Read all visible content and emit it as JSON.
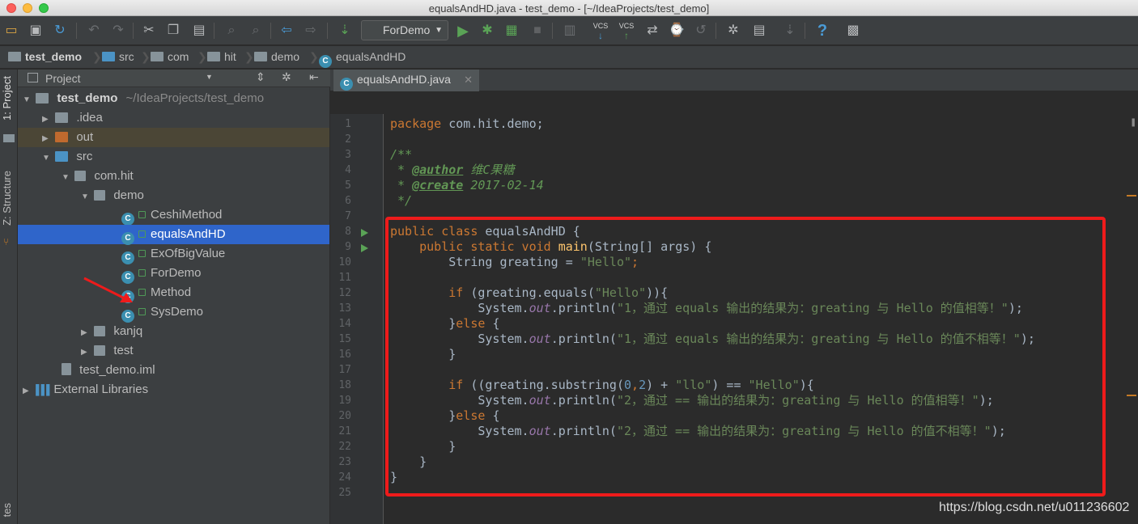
{
  "window": {
    "title": "equalsAndHD.java - test_demo - [~/IdeaProjects/test_demo]"
  },
  "toolbar": {
    "run_config": "ForDemo"
  },
  "breadcrumb": [
    "test_demo",
    "src",
    "com",
    "hit",
    "demo",
    "equalsAndHD"
  ],
  "side_tabs": {
    "project": "1: Project",
    "structure": "Z: Structure",
    "favorites": "tes"
  },
  "project_panel": {
    "header": "Project",
    "tree": [
      {
        "label": "test_demo",
        "extra": "~/IdeaProjects/test_demo"
      },
      {
        "label": ".idea"
      },
      {
        "label": "out"
      },
      {
        "label": "src"
      },
      {
        "label": "com.hit"
      },
      {
        "label": "demo"
      },
      {
        "label": "CeshiMethod"
      },
      {
        "label": "equalsAndHD"
      },
      {
        "label": "ExOfBigValue"
      },
      {
        "label": "ForDemo"
      },
      {
        "label": "Method"
      },
      {
        "label": "SysDemo"
      },
      {
        "label": "kanjq"
      },
      {
        "label": "test"
      },
      {
        "label": "test_demo.iml"
      },
      {
        "label": "External Libraries"
      }
    ]
  },
  "editor": {
    "tab_label": "equalsAndHD.java",
    "line_numbers": [
      "1",
      "2",
      "3",
      "4",
      "5",
      "6",
      "7",
      "8",
      "9",
      "10",
      "11",
      "12",
      "13",
      "14",
      "15",
      "16",
      "17",
      "18",
      "19",
      "20",
      "21",
      "22",
      "23",
      "24",
      "25"
    ]
  },
  "code": {
    "l1a": "package ",
    "l1b": "com.hit.demo;",
    "l3": "/**",
    "l4a": " * ",
    "l4b": "@author",
    "l4c": " 维C果糖",
    "l5a": " * ",
    "l5b": "@create",
    "l5c": " 2017-02-14",
    "l6": " */",
    "l8a": "public class ",
    "l8b": "equalsAndHD {",
    "l9a": "    public static void ",
    "l9b": "main",
    "l9c": "(String[] args) {",
    "l10a": "        String greating = ",
    "l10b": "\"Hello\"",
    "l10c": ";",
    "l12a": "        if ",
    "l12b": "(greating.equals(",
    "l12c": "\"Hello\"",
    "l12d": ")){",
    "l13a": "            System.",
    "l13b": "out",
    "l13c": ".println(",
    "l13d": "\"1，通过 equals 输出的结果为：greating 与 Hello 的值相等！\"",
    "l13e": ");",
    "l14a": "        }",
    "l14b": "else ",
    "l14c": "{",
    "l15a": "            System.",
    "l15b": "out",
    "l15c": ".println(",
    "l15d": "\"1，通过 equals 输出的结果为：greating 与 Hello 的值不相等！\"",
    "l15e": ");",
    "l16": "        }",
    "l18a": "        if ",
    "l18b": "((greating.substring(",
    "l18c": "0",
    "l18d": ",",
    "l18e": "2",
    "l18f": ") + ",
    "l18g": "\"llo\"",
    "l18h": ") == ",
    "l18i": "\"Hello\"",
    "l18j": "){",
    "l19a": "            System.",
    "l19b": "out",
    "l19c": ".println(",
    "l19d": "\"2，通过 == 输出的结果为：greating 与 Hello 的值相等！\"",
    "l19e": ");",
    "l20a": "        }",
    "l20b": "else ",
    "l20c": "{",
    "l21a": "            System.",
    "l21b": "out",
    "l21c": ".println(",
    "l21d": "\"2，通过 == 输出的结果为：greating 与 Hello 的值不相等！\"",
    "l21e": ");",
    "l22": "        }",
    "l23": "    }",
    "l24": "}"
  },
  "watermark": "https://blog.csdn.net/u011236602",
  "colors": {
    "selection": "#2f65ca",
    "annotation_box": "#ee1b1b",
    "keyword": "#cc7832",
    "string": "#6a8759"
  }
}
